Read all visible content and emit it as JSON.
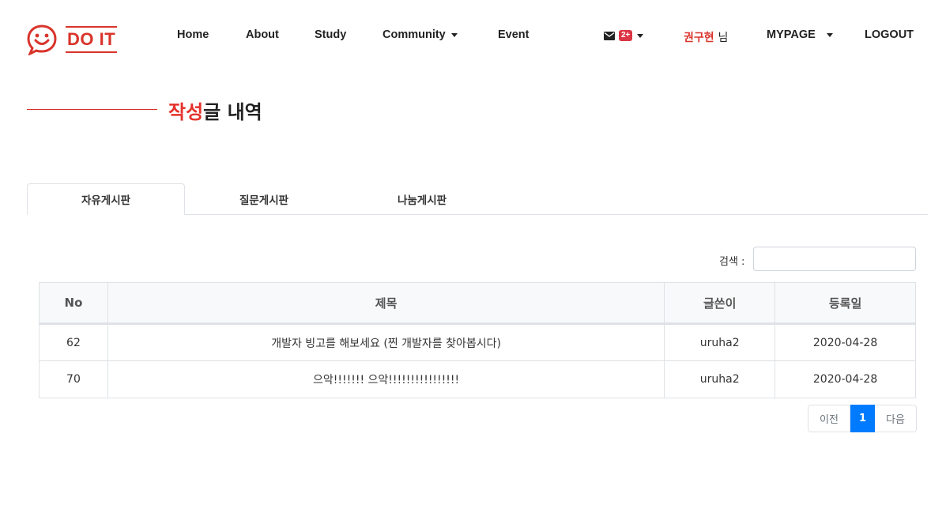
{
  "brand": {
    "name": "DO IT",
    "color": "#d9342b"
  },
  "nav": {
    "items": [
      {
        "label": "Home"
      },
      {
        "label": "About"
      },
      {
        "label": "Study"
      },
      {
        "label": "Community"
      },
      {
        "label": "Event"
      }
    ],
    "mail_badge": "2+",
    "user_name": "권구현",
    "user_suffix": "님",
    "mypage": "MYPAGE",
    "logout": "LOGOUT"
  },
  "page": {
    "title_accent": "작성",
    "title_rest": "글 내역"
  },
  "tabs": [
    {
      "label": "자유게시판",
      "active": true
    },
    {
      "label": "질문게시판",
      "active": false
    },
    {
      "label": "나눔게시판",
      "active": false
    }
  ],
  "search": {
    "label": "검색 :",
    "value": ""
  },
  "table": {
    "headers": [
      "No",
      "제목",
      "글쓴이",
      "등록일"
    ],
    "rows": [
      {
        "no": "62",
        "title": "개발자 빙고를 해보세요 (찐 개발자를 찾아봅시다)",
        "writer": "uruha2",
        "date": "2020-04-28"
      },
      {
        "no": "70",
        "title": "으악!!!!!!! 으악!!!!!!!!!!!!!!!!",
        "writer": "uruha2",
        "date": "2020-04-28"
      }
    ]
  },
  "pagination": {
    "prev": "이전",
    "current": "1",
    "next": "다음"
  },
  "colors": {
    "accent": "#d9342b",
    "primary": "#007bff"
  }
}
